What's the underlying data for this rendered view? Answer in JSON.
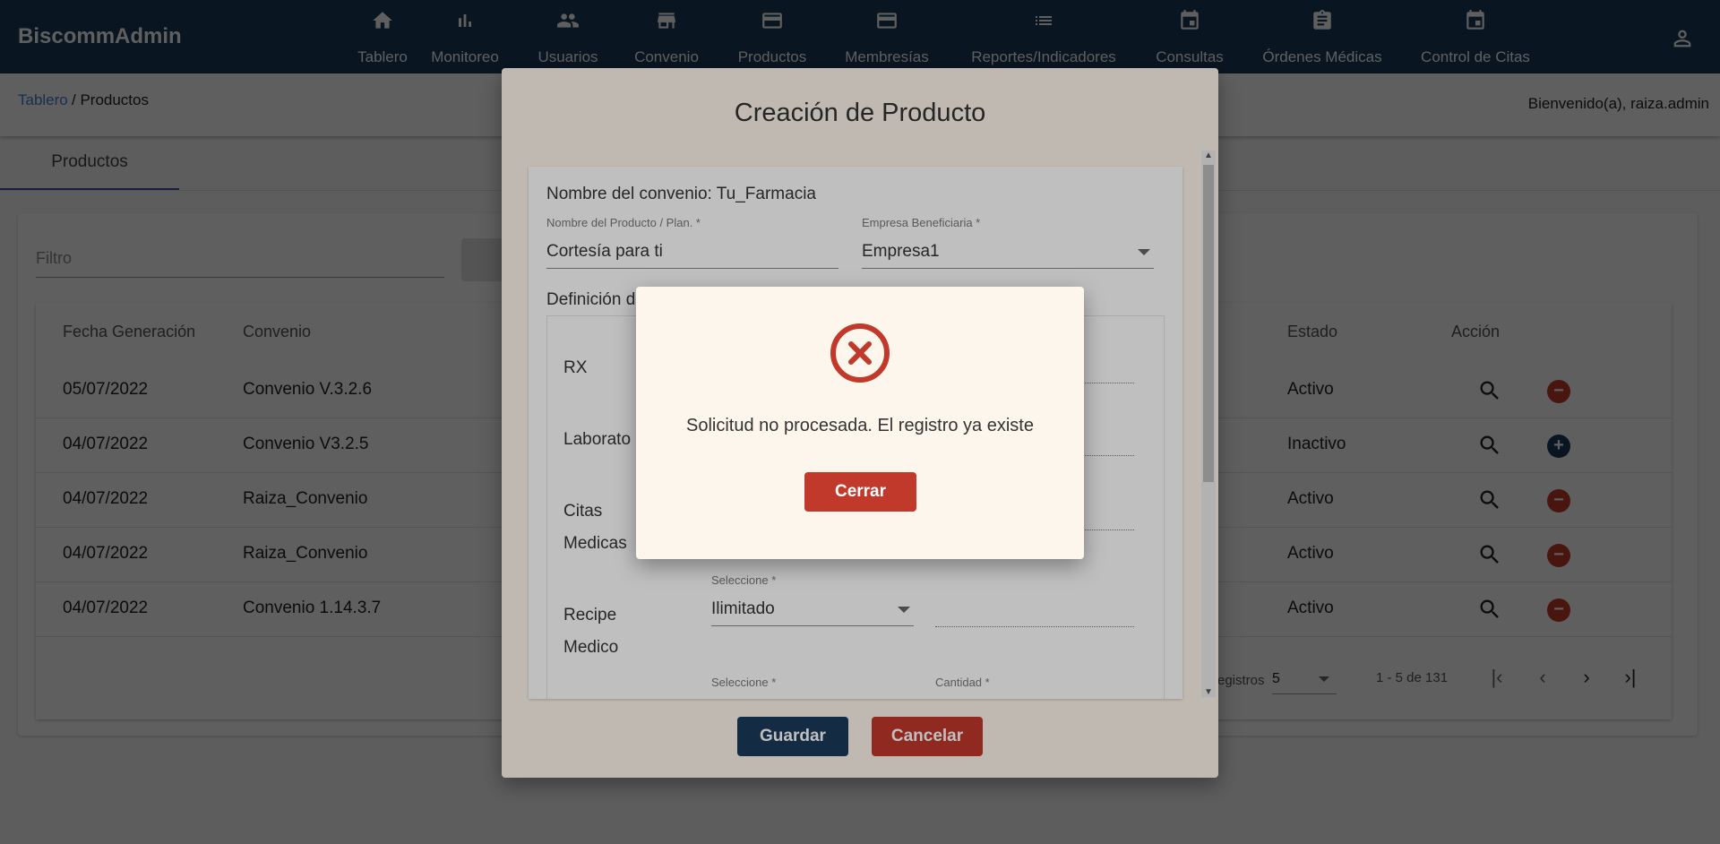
{
  "app": {
    "brand": "BiscommAdmin"
  },
  "nav": {
    "items": [
      {
        "label": "Tablero",
        "icon": "home-icon"
      },
      {
        "label": "Monitoreo",
        "icon": "bar-chart-icon"
      },
      {
        "label": "Usuarios",
        "icon": "people-icon"
      },
      {
        "label": "Convenio",
        "icon": "store-icon"
      },
      {
        "label": "Productos",
        "icon": "card-icon"
      },
      {
        "label": "Membresías",
        "icon": "card-icon"
      },
      {
        "label": "Reportes/Indicadores",
        "icon": "list-icon"
      },
      {
        "label": "Consultas",
        "icon": "calendar-icon"
      },
      {
        "label": "Órdenes Médicas",
        "icon": "clipboard-icon"
      },
      {
        "label": "Control de Citas",
        "icon": "calendar-icon"
      }
    ]
  },
  "breadcrumb": {
    "link": "Tablero",
    "current": "/ Productos"
  },
  "welcome": "Bienvenido(a), raiza.admin",
  "tab": "Productos",
  "filter": {
    "placeholder": "Filtro"
  },
  "table": {
    "headers": [
      "Fecha Generación",
      "Convenio",
      "Estado",
      "Acción"
    ],
    "rows": [
      {
        "fecha": "05/07/2022",
        "convenio": "Convenio V.3.2.6",
        "estado": "Activo",
        "action": "remove"
      },
      {
        "fecha": "04/07/2022",
        "convenio": "Convenio V3.2.5",
        "estado": "Inactivo",
        "action": "add"
      },
      {
        "fecha": "04/07/2022",
        "convenio": "Raiza_Convenio",
        "estado": "Activo",
        "action": "remove"
      },
      {
        "fecha": "04/07/2022",
        "convenio": "Raiza_Convenio",
        "estado": "Activo",
        "action": "remove"
      },
      {
        "fecha": "04/07/2022",
        "convenio": "Convenio 1.14.3.7",
        "estado": "Activo",
        "action": "remove"
      }
    ]
  },
  "pager": {
    "label": "registros",
    "page_size": "5",
    "range": "1 - 5 de 131"
  },
  "dialog": {
    "title": "Creación de Producto",
    "convenio": "Nombre del convenio: Tu_Farmacia",
    "producto": {
      "label": "Nombre del Producto / Plan. *",
      "value": "Cortesía para ti"
    },
    "empresa": {
      "label": "Empresa Beneficiaria *",
      "value": "Empresa1"
    },
    "definicion": "Definición d",
    "rows": {
      "rx": "RX",
      "lab": "Laborato",
      "citas_1": "Citas",
      "citas_2": "Medicas",
      "recipe_1": "Recipe",
      "recipe_2": "Medico"
    },
    "recipe_select": {
      "label": "Seleccione *",
      "value": "Ilimitado"
    },
    "next_select": {
      "label": "Seleccione *"
    },
    "next_cantidad": {
      "label": "Cantidad *"
    },
    "guardar": "Guardar",
    "cancelar": "Cancelar"
  },
  "alert": {
    "message": "Solicitud no procesada. El registro ya existe",
    "button": "Cerrar"
  },
  "colors": {
    "navbar": "#1b3a5b",
    "primary_button": "#1b3a5b",
    "danger": "#c0392b",
    "link": "#3f7fd6"
  }
}
